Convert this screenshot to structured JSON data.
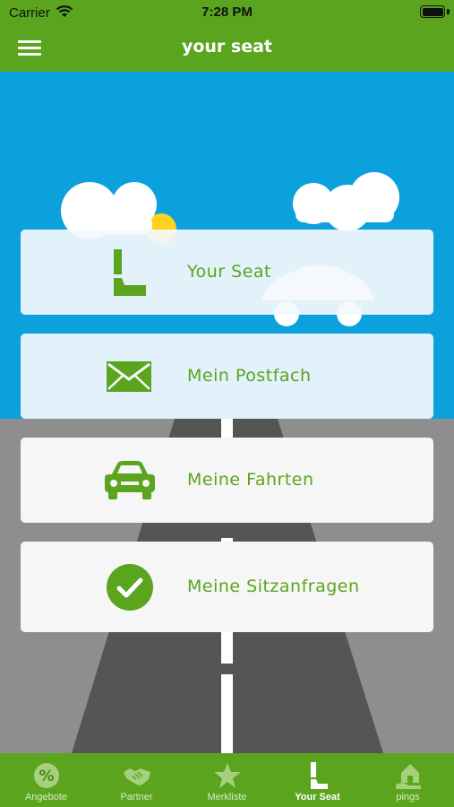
{
  "status_bar": {
    "carrier": "Carrier",
    "time": "7:28 PM",
    "wifi_icon": "wifi-icon",
    "battery_icon": "battery-icon"
  },
  "nav": {
    "title": "your seat",
    "menu_icon": "hamburger-menu-icon"
  },
  "colors": {
    "brand_green": "#5aa51d",
    "sky_blue": "#0aa1dc",
    "road_gray": "#555555",
    "card_background": "#f6f6f6"
  },
  "menu_cards": [
    {
      "label": "Your Seat",
      "icon": "seat-icon"
    },
    {
      "label": "Mein Postfach",
      "icon": "envelope-icon"
    },
    {
      "label": "Meine Fahrten",
      "icon": "car-icon"
    },
    {
      "label": "Meine Sitzanfragen",
      "icon": "checkmark-circle-icon"
    }
  ],
  "tab_bar": {
    "tabs": [
      {
        "label": "Angebote",
        "icon": "percent-badge-icon",
        "active": false
      },
      {
        "label": "Partner",
        "icon": "handshake-icon",
        "active": false
      },
      {
        "label": "Merkliste",
        "icon": "star-icon",
        "active": false
      },
      {
        "label": "Your Seat",
        "icon": "seat-icon",
        "active": true
      },
      {
        "label": "pings",
        "icon": "house-hand-icon",
        "active": false
      }
    ]
  }
}
